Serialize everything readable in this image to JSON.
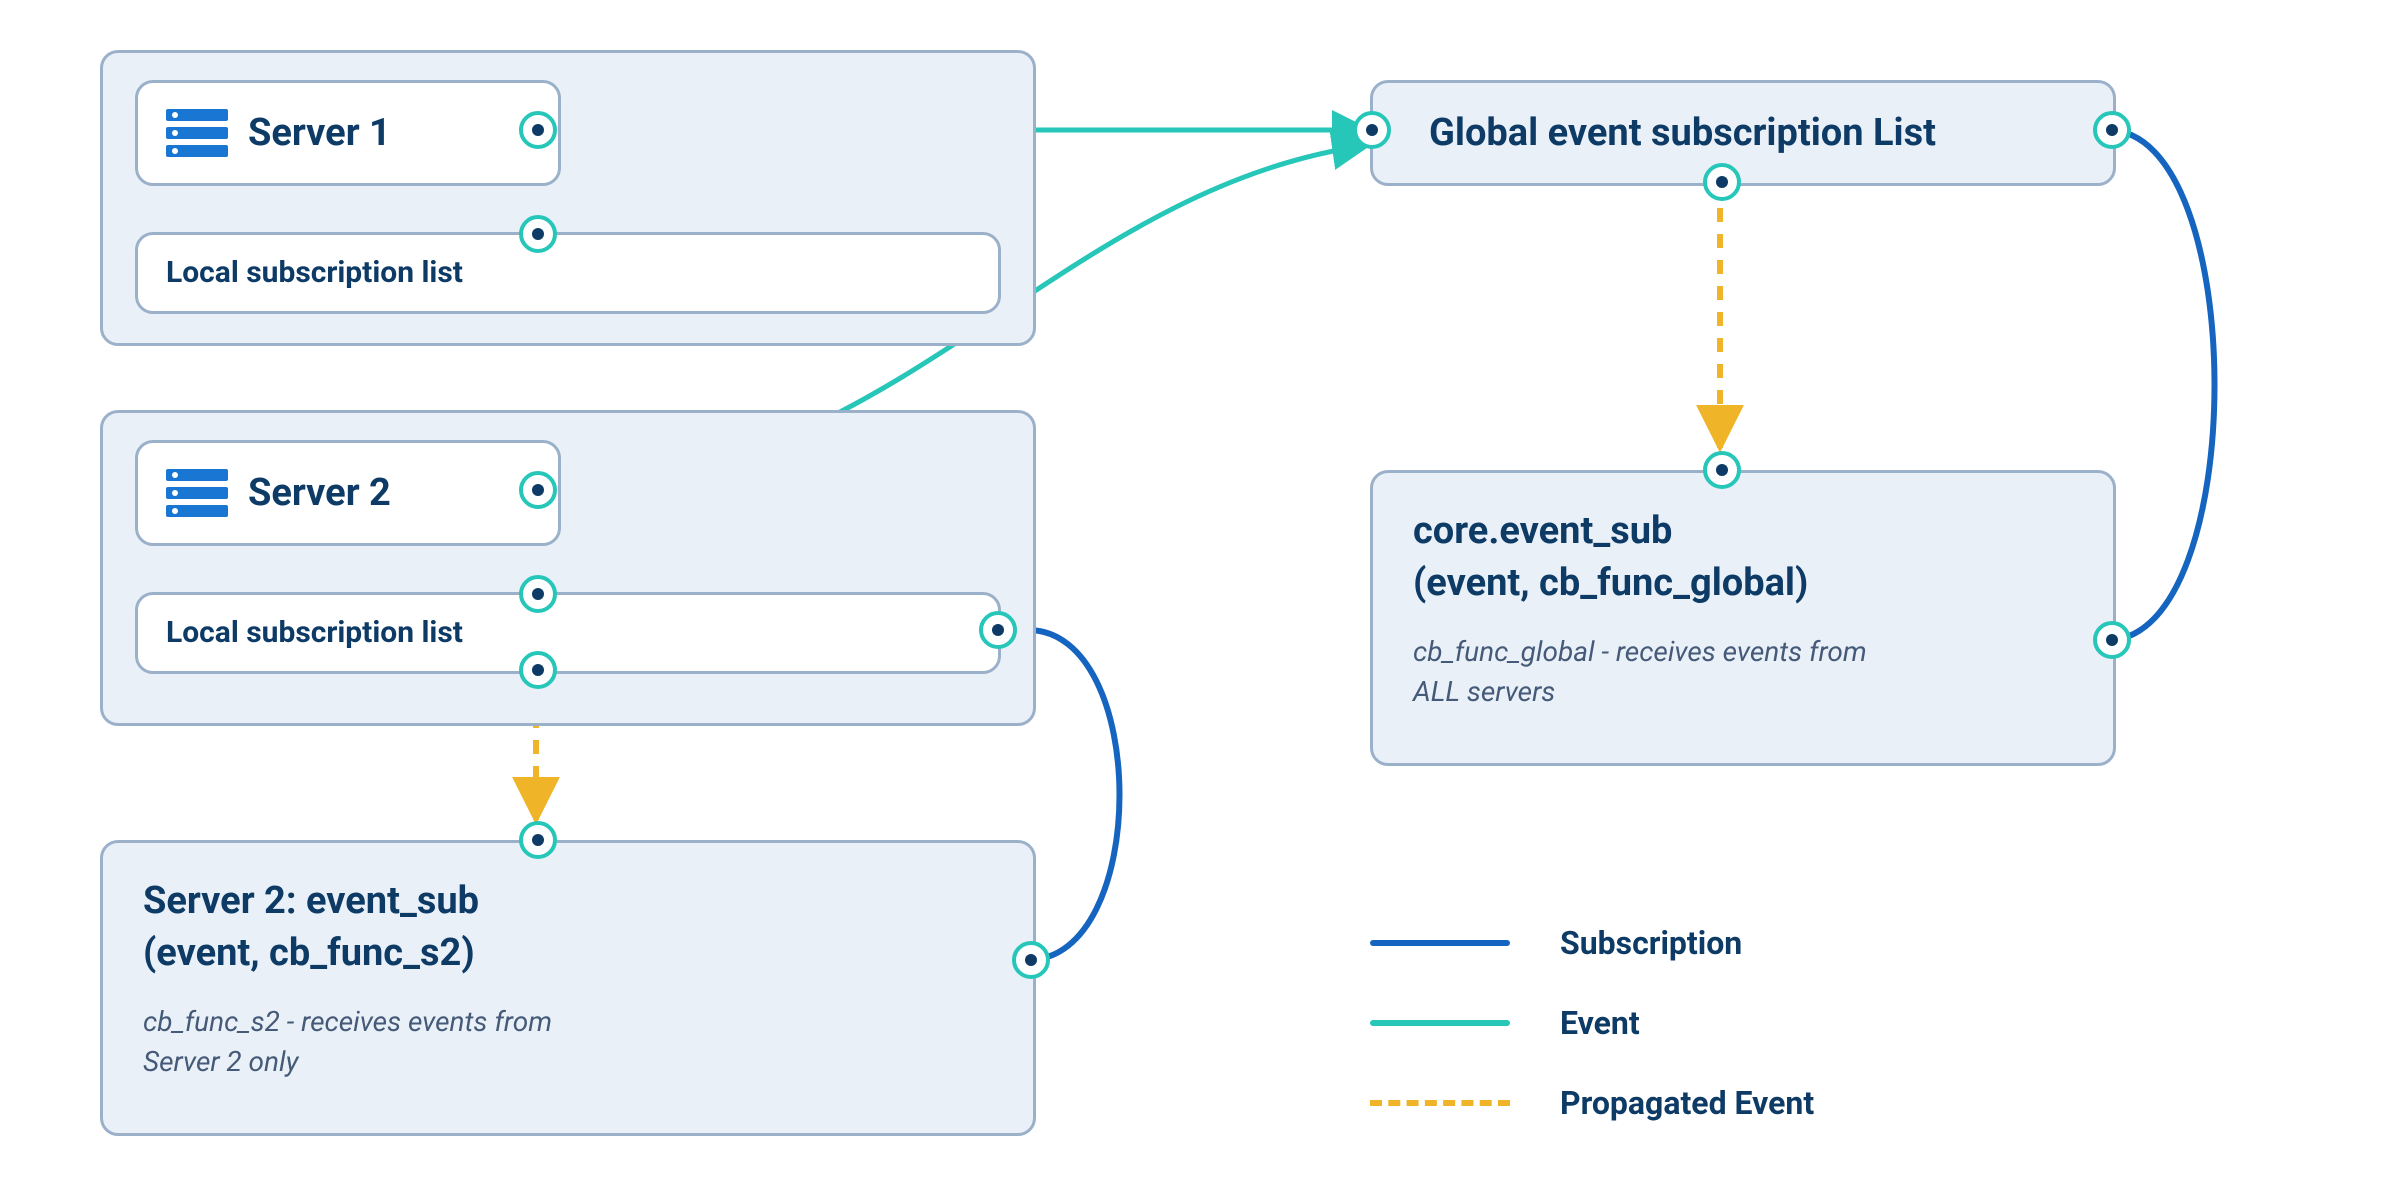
{
  "server1": {
    "title": "Server 1",
    "sublist_label": "Local subscription list"
  },
  "server2": {
    "title": "Server 2",
    "sublist_label": "Local subscription list"
  },
  "server2_detail": {
    "title_line1": "Server 2: event_sub",
    "title_line2": "(event, cb_func_s2)",
    "desc_line1": "cb_func_s2 - receives events from",
    "desc_line2": "Server 2 only"
  },
  "global_box": {
    "title": "Global event subscription List"
  },
  "global_detail": {
    "title_line1": "core.event_sub",
    "title_line2": "(event, cb_func_global)",
    "desc_line1": "cb_func_global - receives events from",
    "desc_line2": "ALL servers"
  },
  "legend": {
    "subscription": "Subscription",
    "event": "Event",
    "propagated": "Propagated Event"
  },
  "colors": {
    "subscription": "#1565c0",
    "event": "#26c6b9",
    "propagated": "#f0b429"
  }
}
